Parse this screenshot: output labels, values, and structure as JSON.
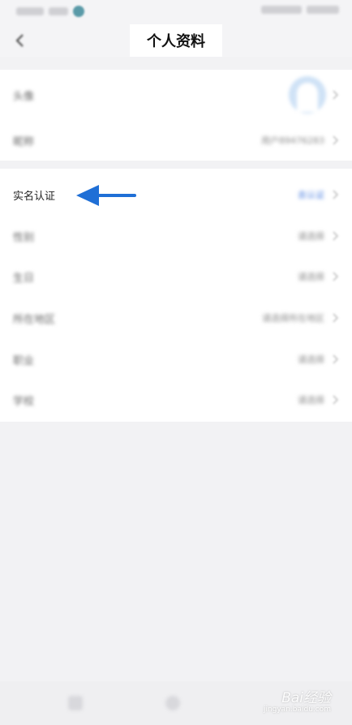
{
  "status_bar": {
    "time": "10:03",
    "battery": "100%"
  },
  "nav": {
    "title": "个人资料"
  },
  "profile_group": {
    "avatar_label": "头像",
    "nickname_label": "昵称",
    "nickname_value": "用户89476283"
  },
  "info_group": {
    "rows": [
      {
        "label": "实名认证",
        "value": "去认证"
      },
      {
        "label": "性别",
        "value": "请选择"
      },
      {
        "label": "生日",
        "value": "请选择"
      },
      {
        "label": "所在地区",
        "value": "请选择所在地区"
      },
      {
        "label": "职业",
        "value": "请选择"
      },
      {
        "label": "学校",
        "value": "请选择"
      }
    ]
  },
  "annotation": {
    "arrow_color": "#1f6fd6"
  },
  "watermark": {
    "logo": "Bai经验",
    "sub": "jingyan.baidu.com"
  }
}
